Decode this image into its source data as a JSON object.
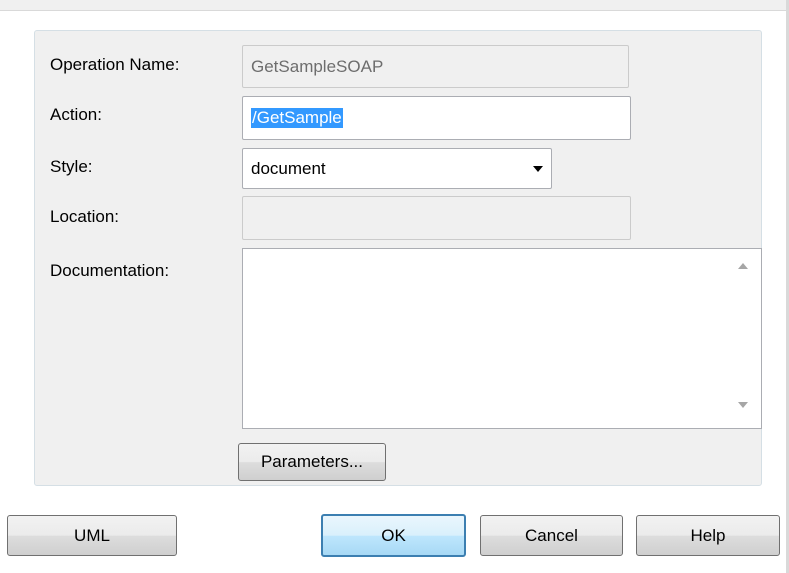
{
  "form": {
    "operation_name_label": "Operation Name:",
    "operation_name_value": "GetSampleSOAP",
    "action_label": "Action:",
    "action_value": "/GetSample",
    "style_label": "Style:",
    "style_selected": "document",
    "location_label": "Location:",
    "location_value": "",
    "documentation_label": "Documentation:",
    "documentation_value": "",
    "parameters_button": "Parameters..."
  },
  "footer": {
    "uml_button": "UML",
    "ok_button": "OK",
    "cancel_button": "Cancel",
    "help_button": "Help"
  },
  "icons": {
    "combo_arrow": "chevron-down-icon",
    "scroll_up": "scroll-up-arrow-icon",
    "scroll_down": "scroll-down-arrow-icon"
  },
  "colors": {
    "selection": "#3399ff",
    "panel_background": "#f0f0f0",
    "default_button_border": "#3c7fb1"
  }
}
